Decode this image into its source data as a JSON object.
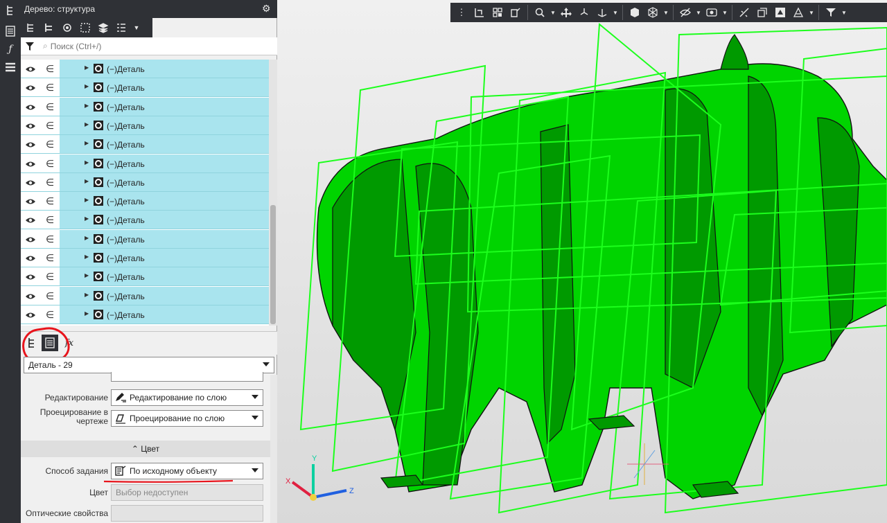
{
  "panel": {
    "title": "Дерево: структура",
    "search_placeholder": "Поиск (Ctrl+/)"
  },
  "tree": {
    "rows": [
      {
        "label": "(−)Деталь"
      },
      {
        "label": "(−)Деталь"
      },
      {
        "label": "(−)Деталь"
      },
      {
        "label": "(−)Деталь"
      },
      {
        "label": "(−)Деталь"
      },
      {
        "label": "(−)Деталь"
      },
      {
        "label": "(−)Деталь"
      },
      {
        "label": "(−)Деталь"
      },
      {
        "label": "(−)Деталь"
      },
      {
        "label": "(−)Деталь"
      },
      {
        "label": "(−)Деталь"
      },
      {
        "label": "(−)Деталь"
      },
      {
        "label": "(−)Деталь"
      },
      {
        "label": "(−)Деталь"
      }
    ]
  },
  "tabs": {
    "fx_label": "fx"
  },
  "object_selector": {
    "value": "Деталь - 29"
  },
  "properties": {
    "editing_label": "Редактирование",
    "editing_value": "Редактирование по слою",
    "projection_label": "Проецирование в чертеже",
    "projection_value": "Проецирование по слою",
    "color_section": "Цвет",
    "method_label": "Способ задания",
    "method_value": "По исходному объекту",
    "color_label": "Цвет",
    "color_value": "Выбор недоступен",
    "optical_label": "Оптические свойства"
  },
  "axes": {
    "x": "X",
    "y": "Y",
    "z": "Z"
  },
  "colors": {
    "dark_ui": "#2f3136",
    "selection": "#a9e4ee",
    "model_green": "#00d400",
    "model_dark_green": "#009a00",
    "wire_green": "#1cff1c",
    "highlight_red": "#e8141c"
  }
}
